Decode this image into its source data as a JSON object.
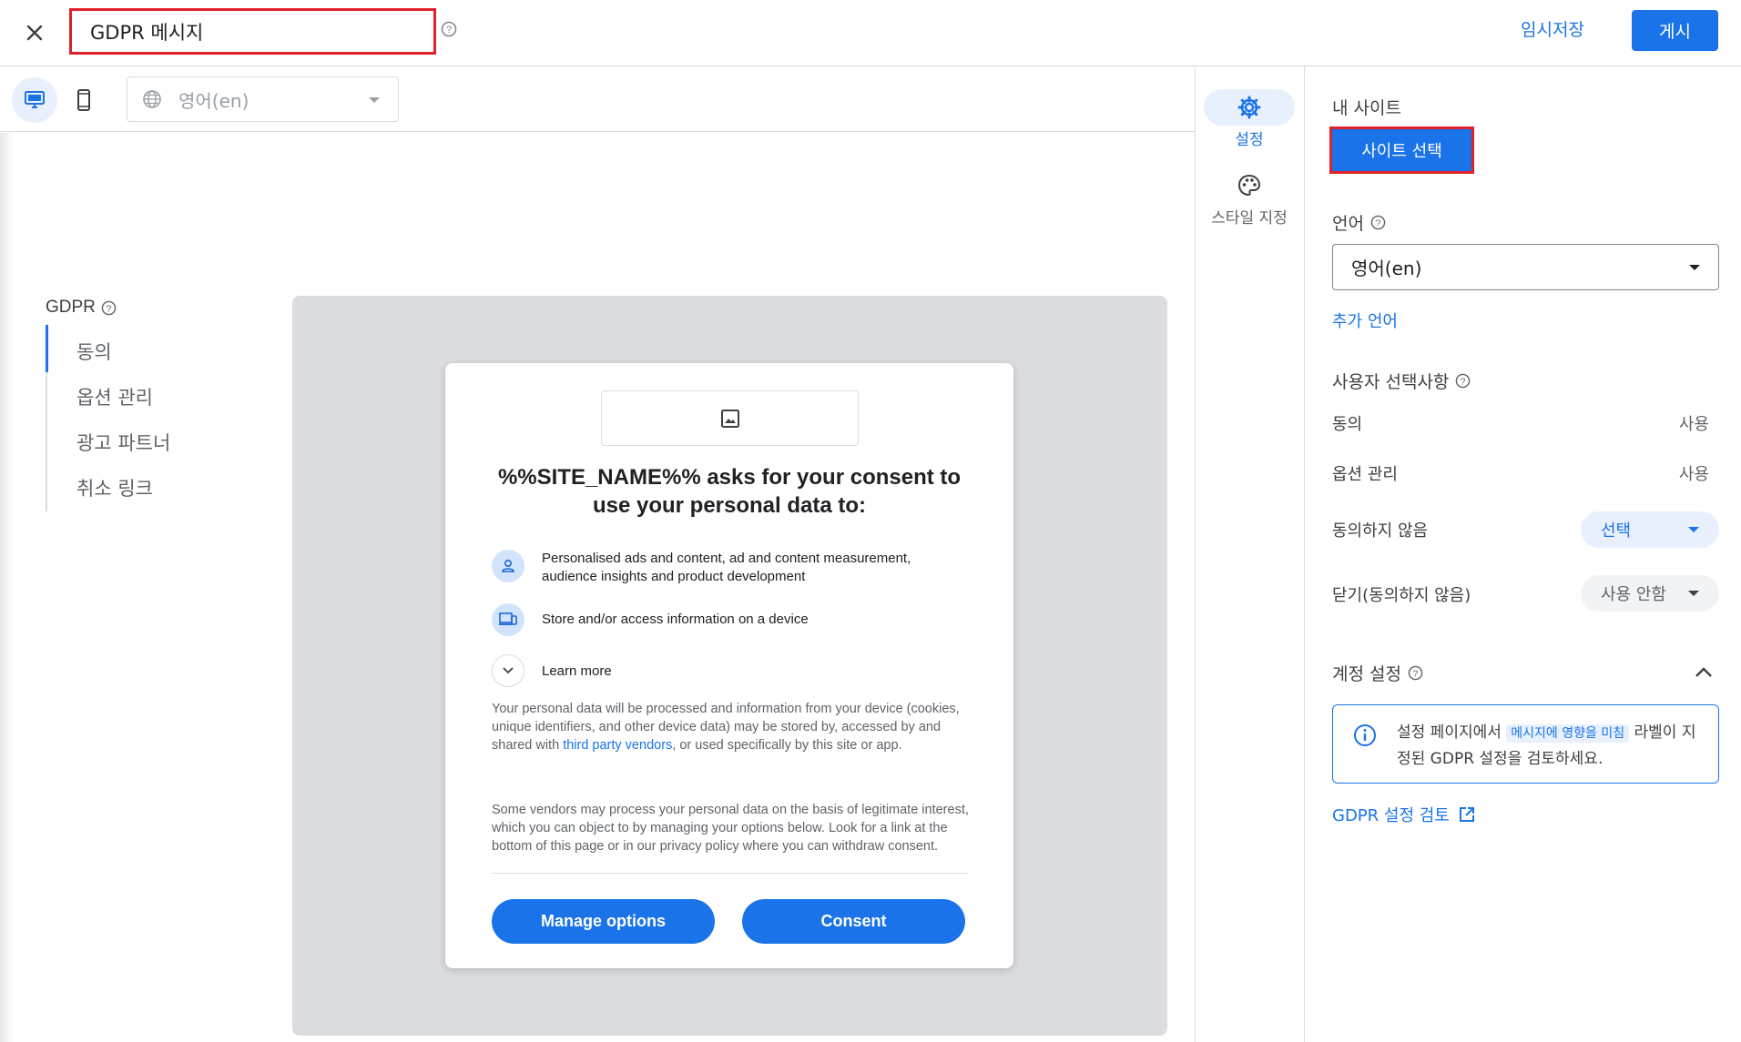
{
  "header": {
    "title_value": "GDPR 메시지",
    "save_draft_label": "임시저장",
    "publish_label": "게시"
  },
  "toolbar": {
    "language_value": "영어(en)"
  },
  "gdpr_nav": {
    "title": "GDPR",
    "items": [
      {
        "label": "동의"
      },
      {
        "label": "옵션 관리"
      },
      {
        "label": "광고 파트너"
      },
      {
        "label": "취소 링크"
      }
    ]
  },
  "dialog": {
    "title": "%%SITE_NAME%% asks for your consent to use your personal data to:",
    "purposes": [
      {
        "icon": "person-icon",
        "text": "Personalised ads and content, ad and content measurement, audience insights and product development"
      },
      {
        "icon": "devices-icon",
        "text": "Store and/or access information on a device"
      }
    ],
    "learn_more": "Learn more",
    "paragraph1_before": "Your personal data will be processed and information from your device (cookies, unique identifiers, and other device data) may be stored by, accessed by and shared with ",
    "paragraph1_link": "third party vendors",
    "paragraph1_after": ", or used specifically by this site or app.",
    "paragraph2": "Some vendors may process your personal data on the basis of legitimate interest, which you can object to by managing your options below. Look for a link at the bottom of this page or in our privacy policy where you can withdraw consent.",
    "manage_options": "Manage options",
    "consent": "Consent"
  },
  "side_tabs": {
    "settings": "설정",
    "style": "스타일 지정"
  },
  "right_panel": {
    "my_site_heading": "내 사이트",
    "select_site_button": "사이트 선택",
    "language_heading": "언어",
    "language_value": "영어(en)",
    "add_language": "추가 언어",
    "user_choices_heading": "사용자 선택사항",
    "rows": [
      {
        "label": "동의",
        "value": "사용"
      },
      {
        "label": "옵션 관리",
        "value": "사용"
      },
      {
        "label": "동의하지 않음",
        "value": "선택"
      },
      {
        "label": "닫기(동의하지 않음)",
        "value": "사용 안함"
      }
    ],
    "account_settings_heading": "계정 설정",
    "info_before": "설정 페이지에서 ",
    "info_tag": "메시지에 영향을 미침",
    "info_after": " 라벨이 지정된 GDPR 설정을 검토하세요.",
    "review_link": "GDPR 설정 검토"
  },
  "colors": {
    "accent": "#1a73e8",
    "highlight_border": "#e0202a",
    "preview_bg": "#dadce0"
  }
}
